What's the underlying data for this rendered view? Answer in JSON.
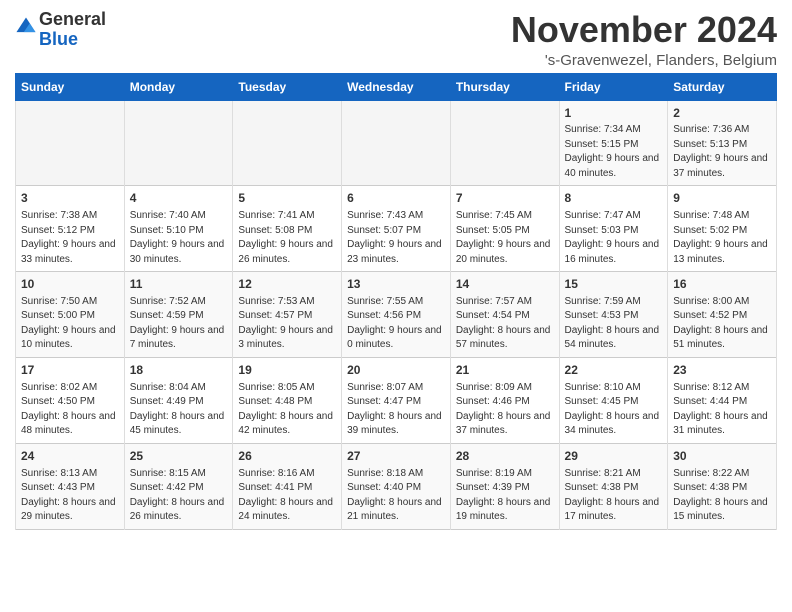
{
  "header": {
    "logo_general": "General",
    "logo_blue": "Blue",
    "month_title": "November 2024",
    "subtitle": "'s-Gravenwezel, Flanders, Belgium"
  },
  "days_of_week": [
    "Sunday",
    "Monday",
    "Tuesday",
    "Wednesday",
    "Thursday",
    "Friday",
    "Saturday"
  ],
  "weeks": [
    [
      {
        "day": "",
        "info": ""
      },
      {
        "day": "",
        "info": ""
      },
      {
        "day": "",
        "info": ""
      },
      {
        "day": "",
        "info": ""
      },
      {
        "day": "",
        "info": ""
      },
      {
        "day": "1",
        "info": "Sunrise: 7:34 AM\nSunset: 5:15 PM\nDaylight: 9 hours and 40 minutes."
      },
      {
        "day": "2",
        "info": "Sunrise: 7:36 AM\nSunset: 5:13 PM\nDaylight: 9 hours and 37 minutes."
      }
    ],
    [
      {
        "day": "3",
        "info": "Sunrise: 7:38 AM\nSunset: 5:12 PM\nDaylight: 9 hours and 33 minutes."
      },
      {
        "day": "4",
        "info": "Sunrise: 7:40 AM\nSunset: 5:10 PM\nDaylight: 9 hours and 30 minutes."
      },
      {
        "day": "5",
        "info": "Sunrise: 7:41 AM\nSunset: 5:08 PM\nDaylight: 9 hours and 26 minutes."
      },
      {
        "day": "6",
        "info": "Sunrise: 7:43 AM\nSunset: 5:07 PM\nDaylight: 9 hours and 23 minutes."
      },
      {
        "day": "7",
        "info": "Sunrise: 7:45 AM\nSunset: 5:05 PM\nDaylight: 9 hours and 20 minutes."
      },
      {
        "day": "8",
        "info": "Sunrise: 7:47 AM\nSunset: 5:03 PM\nDaylight: 9 hours and 16 minutes."
      },
      {
        "day": "9",
        "info": "Sunrise: 7:48 AM\nSunset: 5:02 PM\nDaylight: 9 hours and 13 minutes."
      }
    ],
    [
      {
        "day": "10",
        "info": "Sunrise: 7:50 AM\nSunset: 5:00 PM\nDaylight: 9 hours and 10 minutes."
      },
      {
        "day": "11",
        "info": "Sunrise: 7:52 AM\nSunset: 4:59 PM\nDaylight: 9 hours and 7 minutes."
      },
      {
        "day": "12",
        "info": "Sunrise: 7:53 AM\nSunset: 4:57 PM\nDaylight: 9 hours and 3 minutes."
      },
      {
        "day": "13",
        "info": "Sunrise: 7:55 AM\nSunset: 4:56 PM\nDaylight: 9 hours and 0 minutes."
      },
      {
        "day": "14",
        "info": "Sunrise: 7:57 AM\nSunset: 4:54 PM\nDaylight: 8 hours and 57 minutes."
      },
      {
        "day": "15",
        "info": "Sunrise: 7:59 AM\nSunset: 4:53 PM\nDaylight: 8 hours and 54 minutes."
      },
      {
        "day": "16",
        "info": "Sunrise: 8:00 AM\nSunset: 4:52 PM\nDaylight: 8 hours and 51 minutes."
      }
    ],
    [
      {
        "day": "17",
        "info": "Sunrise: 8:02 AM\nSunset: 4:50 PM\nDaylight: 8 hours and 48 minutes."
      },
      {
        "day": "18",
        "info": "Sunrise: 8:04 AM\nSunset: 4:49 PM\nDaylight: 8 hours and 45 minutes."
      },
      {
        "day": "19",
        "info": "Sunrise: 8:05 AM\nSunset: 4:48 PM\nDaylight: 8 hours and 42 minutes."
      },
      {
        "day": "20",
        "info": "Sunrise: 8:07 AM\nSunset: 4:47 PM\nDaylight: 8 hours and 39 minutes."
      },
      {
        "day": "21",
        "info": "Sunrise: 8:09 AM\nSunset: 4:46 PM\nDaylight: 8 hours and 37 minutes."
      },
      {
        "day": "22",
        "info": "Sunrise: 8:10 AM\nSunset: 4:45 PM\nDaylight: 8 hours and 34 minutes."
      },
      {
        "day": "23",
        "info": "Sunrise: 8:12 AM\nSunset: 4:44 PM\nDaylight: 8 hours and 31 minutes."
      }
    ],
    [
      {
        "day": "24",
        "info": "Sunrise: 8:13 AM\nSunset: 4:43 PM\nDaylight: 8 hours and 29 minutes."
      },
      {
        "day": "25",
        "info": "Sunrise: 8:15 AM\nSunset: 4:42 PM\nDaylight: 8 hours and 26 minutes."
      },
      {
        "day": "26",
        "info": "Sunrise: 8:16 AM\nSunset: 4:41 PM\nDaylight: 8 hours and 24 minutes."
      },
      {
        "day": "27",
        "info": "Sunrise: 8:18 AM\nSunset: 4:40 PM\nDaylight: 8 hours and 21 minutes."
      },
      {
        "day": "28",
        "info": "Sunrise: 8:19 AM\nSunset: 4:39 PM\nDaylight: 8 hours and 19 minutes."
      },
      {
        "day": "29",
        "info": "Sunrise: 8:21 AM\nSunset: 4:38 PM\nDaylight: 8 hours and 17 minutes."
      },
      {
        "day": "30",
        "info": "Sunrise: 8:22 AM\nSunset: 4:38 PM\nDaylight: 8 hours and 15 minutes."
      }
    ]
  ]
}
